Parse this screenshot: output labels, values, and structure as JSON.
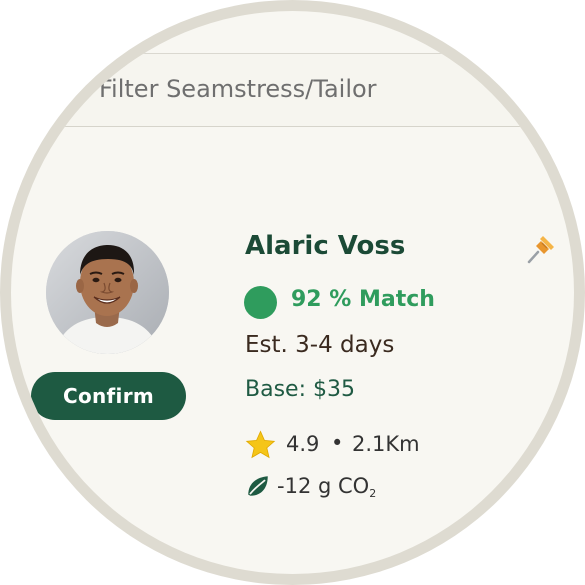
{
  "filter": {
    "placeholder": "Filter Seamstress/Tailor"
  },
  "profile": {
    "name": "Alaric Voss",
    "match_text": "92 % Match",
    "estimate": "Est. 3-4 days",
    "base_price": "Base: $35",
    "rating": "4.9",
    "separator": "•",
    "distance": "2.1Km",
    "co2_prefix": "-12 g CO",
    "co2_sub": "2",
    "avatar_icon": "person-avatar",
    "pin_icon": "pushpin-icon",
    "star_icon": "star-icon",
    "leaf_icon": "leaf-icon"
  },
  "actions": {
    "confirm_label": "Confirm"
  },
  "colors": {
    "brand_green": "#1e5a42",
    "match_green": "#2f9c5d",
    "star_yellow": "#f5c518",
    "pin_orange": "#f0a73a"
  }
}
